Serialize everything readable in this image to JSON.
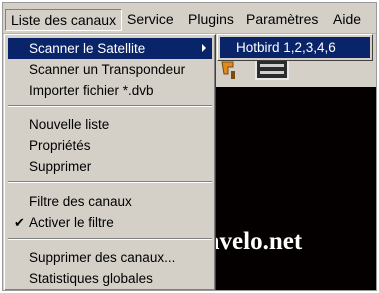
{
  "menubar": {
    "items": [
      {
        "label": "Liste des canaux"
      },
      {
        "label": "Service"
      },
      {
        "label": "Plugins"
      },
      {
        "label": "Paramètres"
      },
      {
        "label": "Aide"
      }
    ]
  },
  "dropdown": {
    "items": [
      {
        "label": "Scanner le Satellite"
      },
      {
        "label": "Scanner un Transpondeur"
      },
      {
        "label": "Importer fichier *.dvb"
      },
      {
        "label": "Nouvelle liste"
      },
      {
        "label": "Propriétés"
      },
      {
        "label": "Supprimer"
      },
      {
        "label": "Filtre des canaux"
      },
      {
        "label": "Activer le filtre",
        "checked": true
      },
      {
        "label": "Supprimer des canaux..."
      },
      {
        "label": "Statistiques globales"
      }
    ]
  },
  "submenu": {
    "items": [
      {
        "label": "Hotbird 1,2,3,4,6"
      }
    ]
  },
  "watermark": "www.avelo.net",
  "colors": {
    "highlight": "#0a246a",
    "menu_face": "#d4d0c8",
    "video_bg": "#050000"
  }
}
